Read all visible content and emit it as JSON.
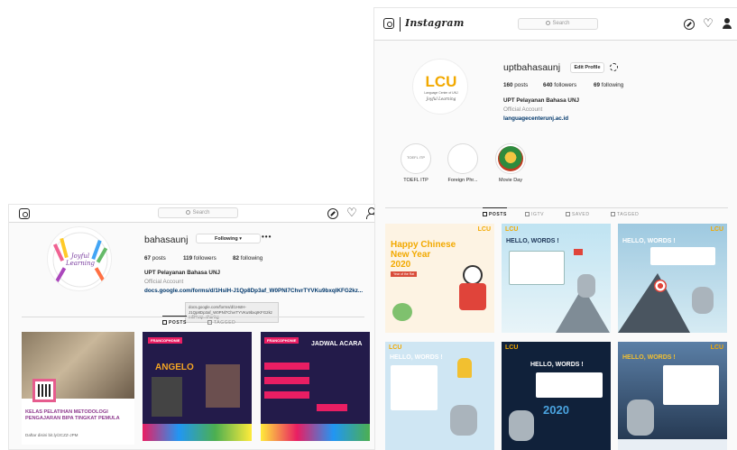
{
  "right": {
    "brand": "Instagram",
    "search_placeholder": "Search",
    "avatar_brand": "LCU",
    "avatar_sub": "Language Center of UNJ",
    "avatar_script": "Joyful Learning",
    "username": "uptbahasaunj",
    "edit_profile_label": "Edit Profile",
    "posts_count": "160",
    "posts_label": "posts",
    "followers_count": "640",
    "followers_label": "followers",
    "following_count": "69",
    "following_label": "following",
    "full_name": "UPT Pelayanan Bahasa UNJ",
    "category": "Official Account",
    "website": "languagecenterunj.ac.id",
    "highlights": [
      {
        "label": "TOEFL ITP",
        "inner": "TOEFL ITP"
      },
      {
        "label": "Foreign Phr...",
        "inner": ""
      },
      {
        "label": "Movie Day",
        "inner": ""
      }
    ],
    "tabs": [
      "POSTS",
      "IGTV",
      "SAVED",
      "TAGGED"
    ],
    "posts": [
      {
        "title_line1": "Happy Chinese",
        "title_line2": "New Year",
        "title_line3": "2020",
        "brand": "LCU",
        "ribbon": "Year of the Rat"
      },
      {
        "title": "HELLO, WORDS !",
        "brand": "LCU"
      },
      {
        "title": "HELLO, WORDS !",
        "brand": "LCU"
      },
      {
        "title": "HELLO, WORDS !",
        "brand": "LCU"
      },
      {
        "title": "HELLO, WORDS !",
        "brand": "LCU",
        "year": "2020"
      },
      {
        "title": "HELLO, WORDS !",
        "brand": "LCU"
      }
    ]
  },
  "left": {
    "search_placeholder": "Search",
    "username": "bahasaunj",
    "following_label": "Following",
    "more_label": "•••",
    "posts_count": "67",
    "posts_label": "posts",
    "followers_count": "119",
    "followers_label": "followers",
    "following_count": "82",
    "following_word": "following",
    "full_name": "UPT Pelayanan Bahasa UNJ",
    "category": "Official Account",
    "link": "docs.google.com/forms/d/1HsIH-J1Qp8Dp3af_W0PNl7ChvrTYVKu9bxqIKFG2kz...",
    "tooltip_line1": "docs.google.com/forms/d/1HsIH-",
    "tooltip_line2": "J1Qp8Dp3af_W0PNl7ChvrTYVKu9bxqIKFG2kz",
    "tooltip_line3": "edit?usp=sharing",
    "tabs": [
      "POSTS",
      "TAGGED"
    ],
    "posts": [
      {
        "title_line1": "KELAS PELATIHAN METODOLOGI",
        "title_line2": "PENGAJARAN BIPA TINGKAT PEMULA",
        "footer": "Daftar disini bit.ly/2CZZ-JPM"
      },
      {
        "title": "ANGELO",
        "tag": "FRANCOPHONIE"
      },
      {
        "title": "JADWAL ACARA",
        "tag": "FRANCOPHONIE"
      }
    ]
  }
}
